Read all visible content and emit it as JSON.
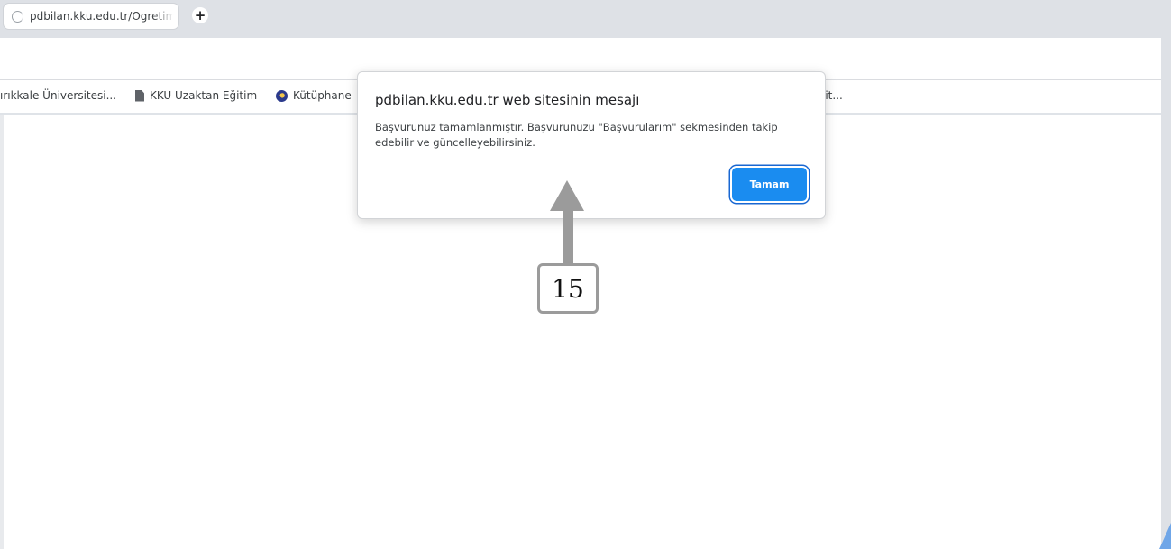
{
  "browser": {
    "tab": {
      "title": "pdbilan.kku.edu.tr/Ogretim",
      "status": "loading"
    },
    "new_tab_symbol": "+",
    "bookmarks": [
      {
        "label": "ırıkkale Üniversitesi...",
        "icon": ""
      },
      {
        "label": "KKU Uzaktan Eğitim",
        "icon": "document-icon"
      },
      {
        "label": "Kütüphane",
        "icon": "library-icon"
      },
      {
        "label": "lit...",
        "icon": ""
      }
    ]
  },
  "dialog": {
    "title": "pdbilan.kku.edu.tr web sitesinin mesajı",
    "message": " Başvurunuz tamamlanmıştır. Başvurunuzu \"Başvurularım\" sekmesinden takip edebilir ve güncelleyebilirsiniz.",
    "ok_label": "Tamam",
    "accent_color": "#1a8cf0"
  },
  "annotation": {
    "step_number": "15",
    "color": "#9b9b9b"
  }
}
